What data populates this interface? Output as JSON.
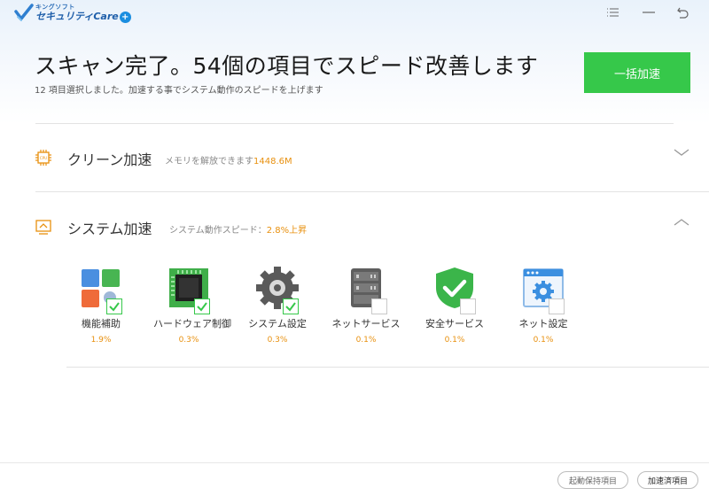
{
  "app": {
    "brand_small": "キングソフト",
    "brand_name": "セキュリティCare",
    "brand_badge": "+"
  },
  "window_controls": [
    {
      "name": "menu-icon"
    },
    {
      "name": "minimize-icon"
    },
    {
      "name": "back-icon"
    }
  ],
  "header": {
    "headline": "スキャン完了。54個の項目でスピード改善します",
    "subline": "12 項目選択しました。加速する事でシステム動作のスピードを上げます",
    "boost_all_label": "一括加速"
  },
  "sections": {
    "clean": {
      "icon": "cpu-icon",
      "title": "クリーン加速",
      "desc": "メモリを解放できます",
      "desc_value": "1448.6M",
      "expanded": false
    },
    "system": {
      "icon": "monitor-icon",
      "title": "システム加速",
      "desc": "システム動作スピード：",
      "desc_value": "2.8%上昇",
      "expanded": true
    }
  },
  "items": [
    {
      "name": "機能補助",
      "pct": "1.9%",
      "checked": true,
      "icon": "tiles-icon"
    },
    {
      "name": "ハードウェア制御",
      "pct": "0.3%",
      "checked": true,
      "icon": "chip-icon"
    },
    {
      "name": "システム設定",
      "pct": "0.3%",
      "checked": true,
      "icon": "gear-icon"
    },
    {
      "name": "ネットサービス",
      "pct": "0.1%",
      "checked": false,
      "icon": "server-icon"
    },
    {
      "name": "安全サービス",
      "pct": "0.1%",
      "checked": false,
      "icon": "shield-icon"
    },
    {
      "name": "ネット設定",
      "pct": "0.1%",
      "checked": false,
      "icon": "browser-gear-icon"
    }
  ],
  "footer": {
    "startup_label": "起動保持項目",
    "accelerated_label": "加速済項目"
  },
  "colors": {
    "accent_green": "#36c84a",
    "highlight_orange": "#e8900e",
    "brand_blue": "#1f5faa"
  }
}
